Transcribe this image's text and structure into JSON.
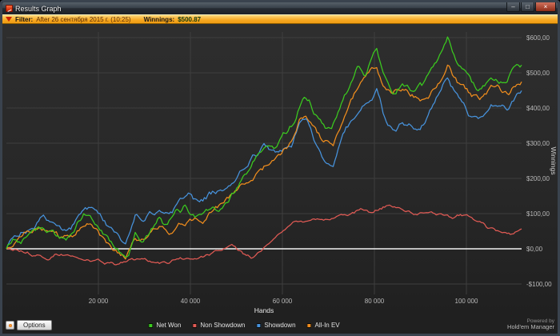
{
  "window": {
    "title": "Results Graph",
    "controls": {
      "minimize": "–",
      "maximize": "□",
      "close": "×"
    }
  },
  "filter": {
    "label": "Filter:",
    "value": "After 26 сентября 2015 г. (10:25)",
    "winnings_label": "Winnings:",
    "winnings_value": "$500.87"
  },
  "chart_data": {
    "type": "line",
    "xlabel": "Hands",
    "ylabel": "Winnings",
    "xlim": [
      0,
      112000
    ],
    "ylim": [
      -130,
      620
    ],
    "grid": true,
    "legend_position": "bottom",
    "zero_line": 0,
    "x_ticks": [
      {
        "value": 20000,
        "label": "20 000"
      },
      {
        "value": 40000,
        "label": "40 000"
      },
      {
        "value": 60000,
        "label": "60 000"
      },
      {
        "value": 80000,
        "label": "80 000"
      },
      {
        "value": 100000,
        "label": "100 000"
      }
    ],
    "y_ticks": [
      {
        "value": 600,
        "label": "$600,00"
      },
      {
        "value": 500,
        "label": "$500,00"
      },
      {
        "value": 400,
        "label": "$400,00"
      },
      {
        "value": 300,
        "label": "$300,00"
      },
      {
        "value": 200,
        "label": "$200,00"
      },
      {
        "value": 100,
        "label": "$100,00"
      },
      {
        "value": 0,
        "label": "$0,00"
      },
      {
        "value": -100,
        "label": "-$100,00"
      }
    ],
    "series": [
      {
        "name": "Net Won",
        "color": "#3bcb1f",
        "points": [
          [
            0,
            0
          ],
          [
            1500,
            25
          ],
          [
            3000,
            15
          ],
          [
            5000,
            55
          ],
          [
            7000,
            80
          ],
          [
            9000,
            65
          ],
          [
            11000,
            45
          ],
          [
            13000,
            30
          ],
          [
            15000,
            60
          ],
          [
            17000,
            95
          ],
          [
            19000,
            75
          ],
          [
            21000,
            45
          ],
          [
            23000,
            15
          ],
          [
            25000,
            -5
          ],
          [
            26500,
            -20
          ],
          [
            28000,
            55
          ],
          [
            29500,
            35
          ],
          [
            31000,
            50
          ],
          [
            33000,
            85
          ],
          [
            35000,
            60
          ],
          [
            37000,
            95
          ],
          [
            39000,
            115
          ],
          [
            41000,
            90
          ],
          [
            43000,
            110
          ],
          [
            45000,
            135
          ],
          [
            47000,
            120
          ],
          [
            49000,
            165
          ],
          [
            51000,
            195
          ],
          [
            53000,
            215
          ],
          [
            55000,
            255
          ],
          [
            57000,
            275
          ],
          [
            58500,
            260
          ],
          [
            60000,
            300
          ],
          [
            61500,
            330
          ],
          [
            63000,
            360
          ],
          [
            64500,
            425
          ],
          [
            66000,
            410
          ],
          [
            67500,
            370
          ],
          [
            69000,
            340
          ],
          [
            70500,
            325
          ],
          [
            72000,
            380
          ],
          [
            73500,
            420
          ],
          [
            75000,
            460
          ],
          [
            76500,
            520
          ],
          [
            78000,
            485
          ],
          [
            79500,
            545
          ],
          [
            80500,
            570
          ],
          [
            81500,
            510
          ],
          [
            83000,
            470
          ],
          [
            84500,
            445
          ],
          [
            86000,
            475
          ],
          [
            87500,
            460
          ],
          [
            89000,
            445
          ],
          [
            90500,
            445
          ],
          [
            92000,
            480
          ],
          [
            93500,
            520
          ],
          [
            95000,
            555
          ],
          [
            96000,
            585
          ],
          [
            97000,
            540
          ],
          [
            98000,
            505
          ],
          [
            99500,
            485
          ],
          [
            101000,
            460
          ],
          [
            102500,
            445
          ],
          [
            104000,
            465
          ],
          [
            105500,
            485
          ],
          [
            107000,
            465
          ],
          [
            108500,
            450
          ],
          [
            110000,
            490
          ],
          [
            112000,
            500
          ]
        ]
      },
      {
        "name": "Non Showdown",
        "color": "#e05a54",
        "points": [
          [
            0,
            0
          ],
          [
            3000,
            -8
          ],
          [
            6000,
            -15
          ],
          [
            9000,
            -22
          ],
          [
            12000,
            -12
          ],
          [
            15000,
            -18
          ],
          [
            18000,
            -28
          ],
          [
            21000,
            -35
          ],
          [
            24000,
            -42
          ],
          [
            27000,
            -30
          ],
          [
            30000,
            -35
          ],
          [
            33000,
            -45
          ],
          [
            36000,
            -38
          ],
          [
            39000,
            -30
          ],
          [
            42000,
            -25
          ],
          [
            45000,
            -15
          ],
          [
            47000,
            5
          ],
          [
            49000,
            15
          ],
          [
            51000,
            -10
          ],
          [
            53000,
            -30
          ],
          [
            55000,
            -15
          ],
          [
            57000,
            10
          ],
          [
            59000,
            35
          ],
          [
            61000,
            55
          ],
          [
            63000,
            70
          ],
          [
            65000,
            80
          ],
          [
            67000,
            88
          ],
          [
            69000,
            82
          ],
          [
            71000,
            90
          ],
          [
            73000,
            95
          ],
          [
            75000,
            100
          ],
          [
            77000,
            108
          ],
          [
            79000,
            100
          ],
          [
            81000,
            110
          ],
          [
            83000,
            122
          ],
          [
            85000,
            112
          ],
          [
            87000,
            102
          ],
          [
            89000,
            96
          ],
          [
            91000,
            100
          ],
          [
            93000,
            95
          ],
          [
            95000,
            88
          ],
          [
            97000,
            82
          ],
          [
            99000,
            88
          ],
          [
            101000,
            95
          ],
          [
            103000,
            85
          ],
          [
            104500,
            65
          ],
          [
            106000,
            58
          ],
          [
            108000,
            48
          ],
          [
            110000,
            42
          ],
          [
            112000,
            50
          ]
        ]
      },
      {
        "name": "Showdown",
        "color": "#4793dd",
        "points": [
          [
            0,
            0
          ],
          [
            2000,
            20
          ],
          [
            4000,
            45
          ],
          [
            6000,
            65
          ],
          [
            8000,
            85
          ],
          [
            10000,
            70
          ],
          [
            12000,
            50
          ],
          [
            14000,
            55
          ],
          [
            16000,
            95
          ],
          [
            18000,
            110
          ],
          [
            20000,
            90
          ],
          [
            22000,
            65
          ],
          [
            24000,
            40
          ],
          [
            26000,
            15
          ],
          [
            28000,
            80
          ],
          [
            30000,
            75
          ],
          [
            32000,
            95
          ],
          [
            34000,
            110
          ],
          [
            36000,
            105
          ],
          [
            38000,
            130
          ],
          [
            40000,
            145
          ],
          [
            42000,
            115
          ],
          [
            44000,
            135
          ],
          [
            46000,
            145
          ],
          [
            48000,
            150
          ],
          [
            50000,
            180
          ],
          [
            52000,
            225
          ],
          [
            54000,
            260
          ],
          [
            56000,
            280
          ],
          [
            58000,
            255
          ],
          [
            60000,
            260
          ],
          [
            62000,
            285
          ],
          [
            64000,
            350
          ],
          [
            65500,
            345
          ],
          [
            67000,
            290
          ],
          [
            69000,
            255
          ],
          [
            71000,
            240
          ],
          [
            73000,
            320
          ],
          [
            75000,
            360
          ],
          [
            77000,
            400
          ],
          [
            79000,
            430
          ],
          [
            80500,
            455
          ],
          [
            82000,
            390
          ],
          [
            84000,
            345
          ],
          [
            86000,
            365
          ],
          [
            88000,
            355
          ],
          [
            90000,
            345
          ],
          [
            92000,
            380
          ],
          [
            94000,
            425
          ],
          [
            96000,
            490
          ],
          [
            97500,
            450
          ],
          [
            99000,
            405
          ],
          [
            101000,
            370
          ],
          [
            103000,
            355
          ],
          [
            105000,
            400
          ],
          [
            107000,
            420
          ],
          [
            109000,
            405
          ],
          [
            111000,
            445
          ],
          [
            112000,
            450
          ]
        ]
      },
      {
        "name": "All-In EV",
        "color": "#f08d1d",
        "points": [
          [
            0,
            0
          ],
          [
            2000,
            15
          ],
          [
            4000,
            35
          ],
          [
            6000,
            55
          ],
          [
            8000,
            60
          ],
          [
            10000,
            50
          ],
          [
            12000,
            35
          ],
          [
            14000,
            40
          ],
          [
            16000,
            70
          ],
          [
            18000,
            80
          ],
          [
            20000,
            55
          ],
          [
            22000,
            30
          ],
          [
            24000,
            0
          ],
          [
            26000,
            -25
          ],
          [
            28000,
            45
          ],
          [
            30000,
            35
          ],
          [
            32000,
            60
          ],
          [
            34000,
            75
          ],
          [
            36000,
            70
          ],
          [
            38000,
            95
          ],
          [
            40000,
            100
          ],
          [
            42000,
            85
          ],
          [
            44000,
            105
          ],
          [
            46000,
            115
          ],
          [
            48000,
            140
          ],
          [
            50000,
            165
          ],
          [
            52000,
            195
          ],
          [
            54000,
            225
          ],
          [
            56000,
            245
          ],
          [
            58000,
            255
          ],
          [
            60000,
            285
          ],
          [
            62000,
            320
          ],
          [
            64000,
            390
          ],
          [
            65500,
            380
          ],
          [
            67000,
            345
          ],
          [
            69000,
            315
          ],
          [
            71000,
            305
          ],
          [
            73000,
            365
          ],
          [
            75000,
            430
          ],
          [
            77000,
            470
          ],
          [
            79000,
            495
          ],
          [
            80500,
            525
          ],
          [
            82000,
            460
          ],
          [
            84000,
            425
          ],
          [
            86000,
            450
          ],
          [
            88000,
            435
          ],
          [
            90000,
            425
          ],
          [
            92000,
            455
          ],
          [
            94000,
            495
          ],
          [
            96000,
            535
          ],
          [
            97500,
            490
          ],
          [
            99000,
            460
          ],
          [
            101000,
            435
          ],
          [
            103000,
            420
          ],
          [
            105000,
            450
          ],
          [
            107000,
            470
          ],
          [
            109000,
            440
          ],
          [
            111000,
            465
          ],
          [
            112000,
            478
          ]
        ]
      }
    ]
  },
  "bottom": {
    "options_label": "Options"
  },
  "branding": {
    "powered_by": "Powered by",
    "app_name": "Hold'em Manager"
  }
}
